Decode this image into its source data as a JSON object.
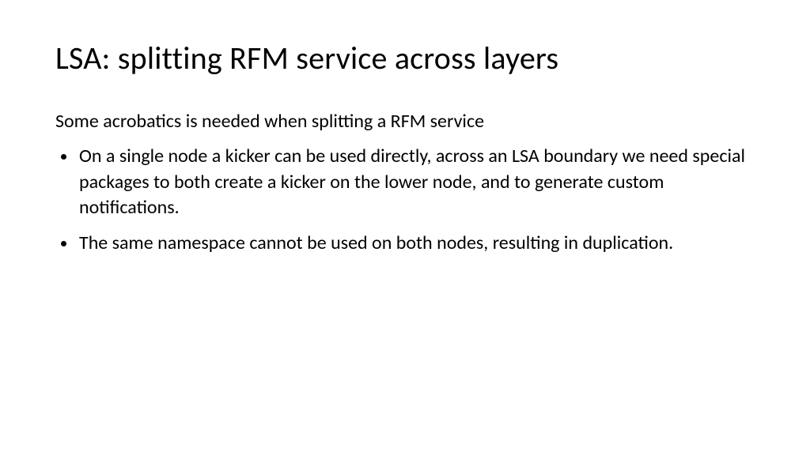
{
  "slide": {
    "title": "LSA: splitting RFM service across layers",
    "lead": "Some acrobatics is needed when splitting a RFM service",
    "bullets": [
      "On a single node a kicker can be used directly, across an LSA boundary we need special packages to both create a kicker on the lower node, and to generate custom notifications.",
      "The same namespace cannot be used on both nodes, resulting in duplication."
    ]
  }
}
